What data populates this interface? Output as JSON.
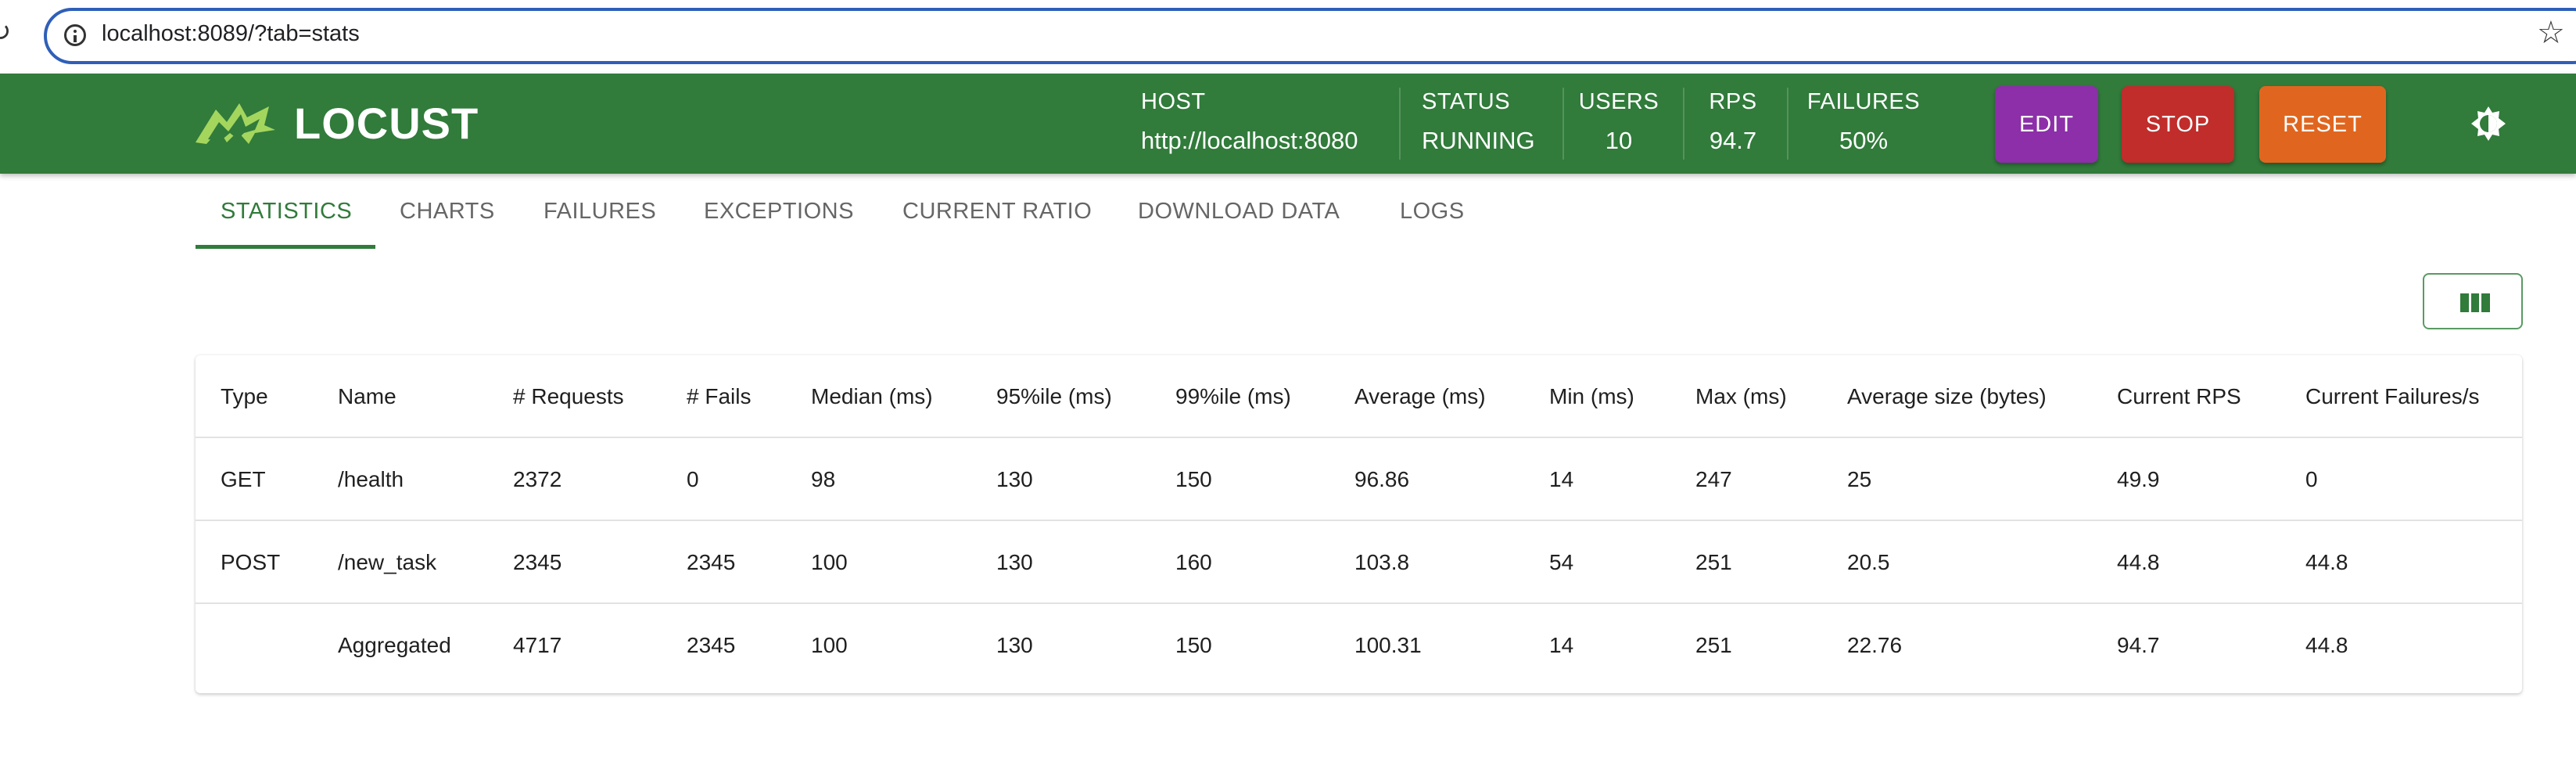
{
  "browser": {
    "url": "localhost:8089/?tab=stats"
  },
  "header": {
    "logo_text": "LOCUST",
    "host_label": "HOST",
    "host_value": "http://localhost:8080",
    "status_label": "STATUS",
    "status_value": "RUNNING",
    "users_label": "USERS",
    "users_value": "10",
    "rps_label": "RPS",
    "rps_value": "94.7",
    "failures_label": "FAILURES",
    "failures_value": "50%",
    "edit_label": "EDIT",
    "stop_label": "STOP",
    "reset_label": "RESET"
  },
  "tabs": [
    {
      "label": "STATISTICS",
      "active": true
    },
    {
      "label": "CHARTS"
    },
    {
      "label": "FAILURES"
    },
    {
      "label": "EXCEPTIONS"
    },
    {
      "label": "CURRENT RATIO"
    },
    {
      "label": "DOWNLOAD DATA"
    },
    {
      "label": "LOGS"
    }
  ],
  "table": {
    "columns": [
      "Type",
      "Name",
      "# Requests",
      "# Fails",
      "Median (ms)",
      "95%ile (ms)",
      "99%ile (ms)",
      "Average (ms)",
      "Min (ms)",
      "Max (ms)",
      "Average size (bytes)",
      "Current RPS",
      "Current Failures/s"
    ],
    "rows": [
      [
        "GET",
        "/health",
        "2372",
        "0",
        "98",
        "130",
        "150",
        "96.86",
        "14",
        "247",
        "25",
        "49.9",
        "0"
      ],
      [
        "POST",
        "/new_task",
        "2345",
        "2345",
        "100",
        "130",
        "160",
        "103.8",
        "54",
        "251",
        "20.5",
        "44.8",
        "44.8"
      ],
      [
        "",
        "Aggregated",
        "4717",
        "2345",
        "100",
        "130",
        "150",
        "100.31",
        "14",
        "251",
        "22.76",
        "94.7",
        "44.8"
      ]
    ]
  },
  "colors": {
    "header_green": "#317b3b",
    "edit": "#8c2fa8",
    "stop": "#c02d2b",
    "reset": "#e0661f",
    "logo_accent": "#a4d65e"
  }
}
